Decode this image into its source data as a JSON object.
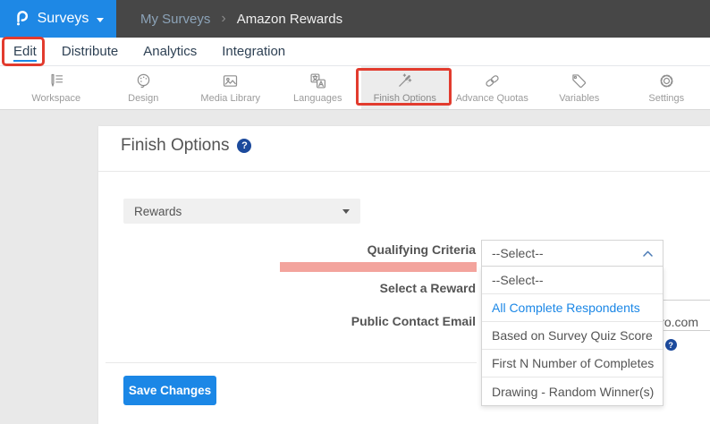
{
  "header": {
    "app": "Surveys",
    "breadcrumb": {
      "parent": "My Surveys",
      "separator": "›",
      "current": "Amazon Rewards"
    }
  },
  "nav": {
    "items": [
      {
        "label": "Edit",
        "active": true,
        "annotated": true
      },
      {
        "label": "Distribute"
      },
      {
        "label": "Analytics"
      },
      {
        "label": "Integration"
      }
    ]
  },
  "toolbar": {
    "items": [
      {
        "label": "Workspace"
      },
      {
        "label": "Design"
      },
      {
        "label": "Media Library"
      },
      {
        "label": "Languages"
      },
      {
        "label": "Finish Options",
        "active": true,
        "annotated": true
      },
      {
        "label": "Advance Quotas"
      },
      {
        "label": "Variables"
      },
      {
        "label": "Settings"
      }
    ]
  },
  "main": {
    "title": "Finish Options",
    "rewards_select_value": "Rewards",
    "fields": {
      "qualifying_criteria": "Qualifying Criteria",
      "select_a_reward": "Select a Reward",
      "public_contact_email": "Public Contact Email"
    },
    "criteria_dropdown": {
      "value": "--Select--",
      "options": [
        {
          "label": "--Select--"
        },
        {
          "label": "All Complete Respondents",
          "highlighted": true
        },
        {
          "label": "Based on Survey Quiz Score"
        },
        {
          "label": "First N Number of Completes"
        },
        {
          "label": "Drawing - Random Winner(s)"
        }
      ]
    },
    "email_value_fragment": "ro.com",
    "email_hint_fragment": ".",
    "save_button": "Save Changes"
  },
  "icons": {
    "help": "?"
  },
  "colors": {
    "brand_blue": "#1e88e5",
    "topbar_dark": "#474747",
    "annotation_red": "#e23b2e",
    "highlight_pink": "#f3a49d",
    "link_blue": "#1b87e6",
    "text_dark": "#545454",
    "help_icon_blue": "#1c4a9c"
  }
}
